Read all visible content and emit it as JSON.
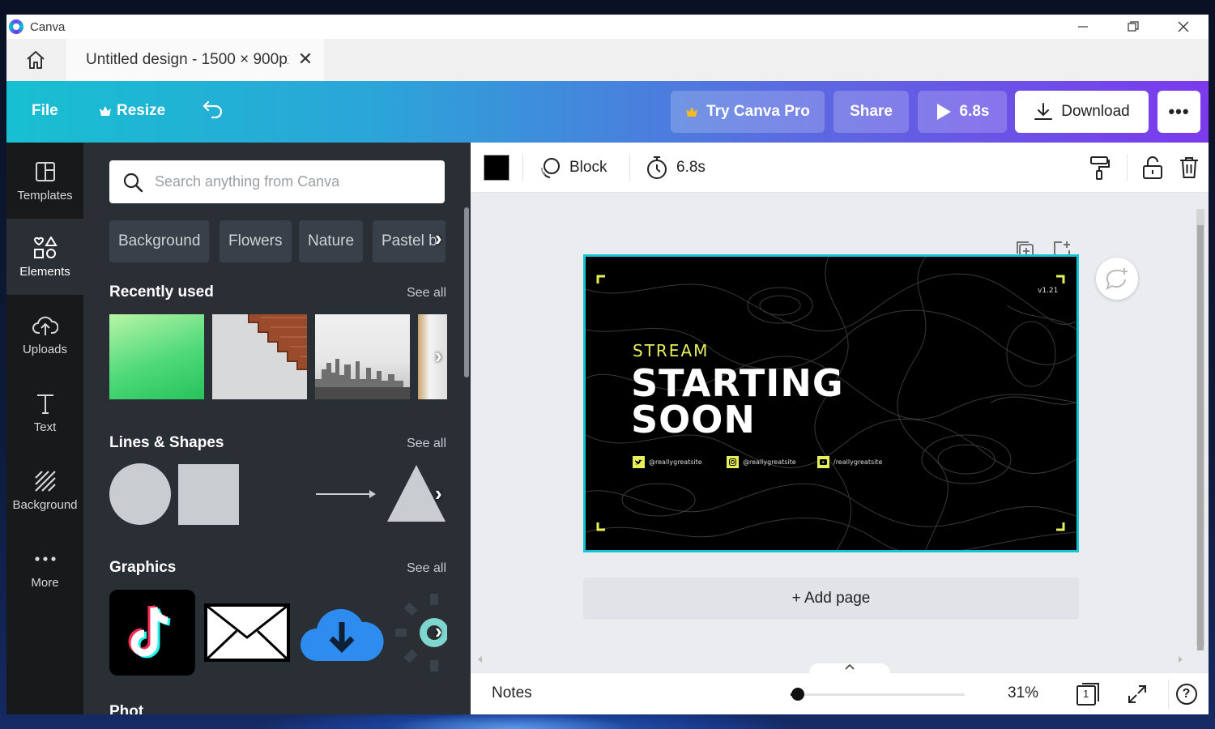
{
  "window": {
    "app_name": "Canva",
    "minimize": "—",
    "restore": "❐",
    "close": "✕"
  },
  "tab": {
    "title": "Untitled design - 1500 × 900px",
    "close": "✕"
  },
  "toolbar": {
    "file": "File",
    "resize": "Resize",
    "try_pro": "Try Canva Pro",
    "share": "Share",
    "play_duration": "6.8s",
    "download": "Download",
    "more": "•••"
  },
  "nav": [
    {
      "label": "Templates",
      "icon": "templates-icon"
    },
    {
      "label": "Elements",
      "icon": "elements-icon"
    },
    {
      "label": "Uploads",
      "icon": "upload-icon"
    },
    {
      "label": "Text",
      "icon": "text-icon"
    },
    {
      "label": "Background",
      "icon": "background-icon"
    },
    {
      "label": "More",
      "icon": "more-icon"
    }
  ],
  "panel": {
    "search_placeholder": "Search anything from Canva",
    "chips": [
      "Background",
      "Flowers",
      "Nature",
      "Pastel b"
    ],
    "recently_used": {
      "title": "Recently used",
      "see_all": "See all"
    },
    "lines_shapes": {
      "title": "Lines & Shapes",
      "see_all": "See all"
    },
    "graphics": {
      "title": "Graphics",
      "see_all": "See all"
    },
    "next_section_partial": "Phot"
  },
  "context_bar": {
    "color": "#000000",
    "animation": "Block",
    "duration": "6.8s"
  },
  "design": {
    "eyebrow": "STREAM",
    "headline_1": "STARTING",
    "headline_2": "SOON",
    "version": "v1.21",
    "socials": [
      {
        "icon": "twitter-icon",
        "handle": "@reallygreatsite"
      },
      {
        "icon": "instagram-icon",
        "handle": "@reallygreatsite"
      },
      {
        "icon": "youtube-icon",
        "handle": "/reallygreatsite"
      }
    ],
    "accent_color": "#e6ef5a",
    "bg_color": "#000000"
  },
  "canvas": {
    "add_page": "+ Add page"
  },
  "bottom": {
    "notes": "Notes",
    "zoom": "31%",
    "zoom_fraction": 0.31,
    "page_count": "1",
    "help": "?"
  },
  "colors": {
    "accent_cyan": "#13c4d6",
    "toolbar_start": "#18bfd1",
    "toolbar_end": "#7c3aed",
    "panel_bg": "#2a2f36",
    "nav_bg": "#18191b"
  }
}
